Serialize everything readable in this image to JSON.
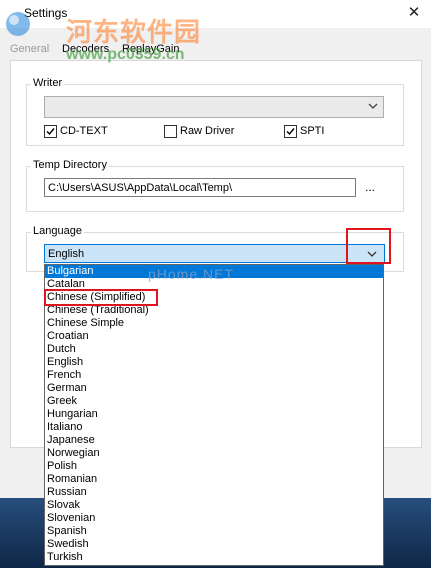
{
  "window": {
    "title": "Settings",
    "close_glyph": "✕"
  },
  "tabs": [
    {
      "label": "General"
    },
    {
      "label": "Decoders"
    },
    {
      "label": "ReplayGain"
    }
  ],
  "writer": {
    "group_label": "Writer",
    "selected": "",
    "checkboxes": [
      {
        "label": "CD-TEXT",
        "checked": true
      },
      {
        "label": "Raw Driver",
        "checked": false
      },
      {
        "label": "SPTI",
        "checked": true
      }
    ]
  },
  "temp_directory": {
    "group_label": "Temp Directory",
    "path": "C:\\Users\\ASUS\\AppData\\Local\\Temp\\",
    "browse_label": "..."
  },
  "language": {
    "group_label": "Language",
    "selected": "English",
    "options": [
      "Bulgarian",
      "Catalan",
      "Chinese (Simplified)",
      "Chinese (Traditional)",
      "Chinese Simple",
      "Croatian",
      "Dutch",
      "English",
      "French",
      "German",
      "Greek",
      "Hungarian",
      "Italiano",
      "Japanese",
      "Norwegian",
      "Polish",
      "Romanian",
      "Russian",
      "Slovak",
      "Slovenian",
      "Spanish",
      "Swedish",
      "Turkish"
    ],
    "highlighted_index": 0
  },
  "watermark": {
    "site_name": "河东软件园",
    "url": "www.pc0359.cn",
    "faint_text": "pHome.NET"
  },
  "colors": {
    "accent": "#0078d7",
    "annotation_red": "#e0141e"
  },
  "icons": {
    "dropdown_arrow": "chevron-down-icon",
    "close": "close-icon",
    "check": "checkmark-icon"
  }
}
